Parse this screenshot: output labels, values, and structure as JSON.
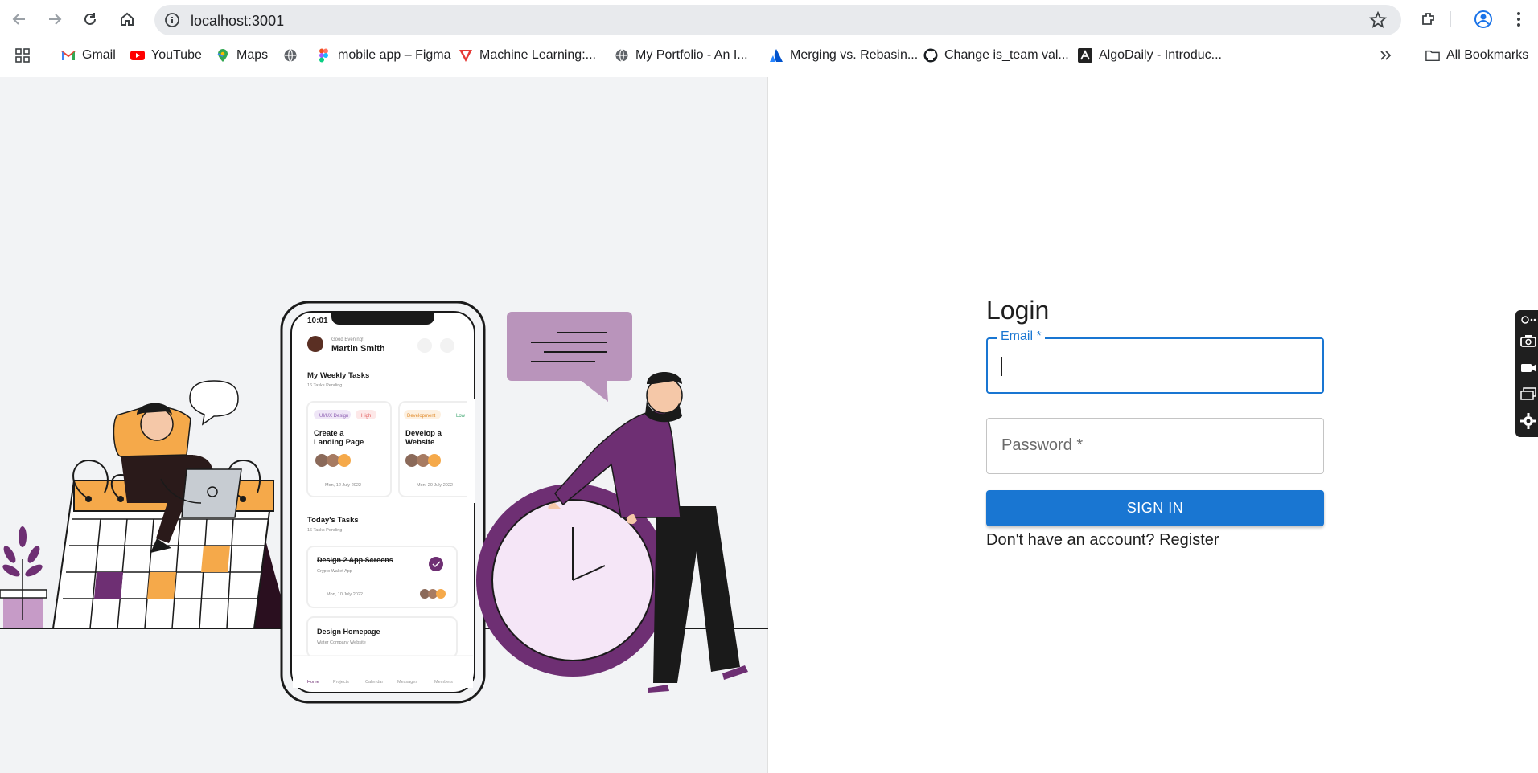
{
  "browser": {
    "url": "localhost:3001",
    "nav": {
      "back": "back-arrow-icon",
      "forward": "forward-arrow-icon",
      "reload": "reload-icon",
      "home": "home-icon"
    }
  },
  "bookmarks": {
    "items": [
      {
        "label": "Gmail",
        "icon": "gmail-icon"
      },
      {
        "label": "YouTube",
        "icon": "youtube-icon"
      },
      {
        "label": "Maps",
        "icon": "maps-icon"
      },
      {
        "label": "",
        "icon": "globe-icon"
      },
      {
        "label": "mobile app – Figma",
        "icon": "figma-icon"
      },
      {
        "label": "Machine Learning:...",
        "icon": "ml-icon"
      },
      {
        "label": "My Portfolio - An I...",
        "icon": "globe-icon"
      },
      {
        "label": "Merging vs. Rebasin...",
        "icon": "atlassian-icon"
      },
      {
        "label": "Change is_team val...",
        "icon": "github-icon"
      },
      {
        "label": "AlgoDaily - Introduc...",
        "icon": "algodaily-icon"
      }
    ],
    "all_bookmarks": "All Bookmarks"
  },
  "hero": {
    "phone": {
      "time": "10:01",
      "greeting": "Good Evening!",
      "user": "Martin Smith",
      "weekly_title": "My Weekly Tasks",
      "weekly_sub": "16 Tasks Pending",
      "card1": {
        "tag1": "UI/UX Design",
        "tag2": "High",
        "title1": "Create a",
        "title2": "Landing Page",
        "date": "Mon, 12 July 2022"
      },
      "card2": {
        "tag1": "Development",
        "tag2": "Low",
        "title1": "Develop a",
        "title2": "Website",
        "date": "Mon, 20 July 2022"
      },
      "today_title": "Today's Tasks",
      "today_sub": "16 Tasks Pending",
      "task1": {
        "title": "Design 2 App Screens",
        "sub": "Crypto Wallet App",
        "date": "Mon, 10 July 2022"
      },
      "task2": {
        "title": "Design Homepage",
        "sub": "Water Company Website"
      },
      "nav": [
        "Home",
        "Projects",
        "Calendar",
        "Messages",
        "Members"
      ]
    }
  },
  "login": {
    "title": "Login",
    "email_label": "Email *",
    "password_label": "Password *",
    "signin": "SIGN IN",
    "register_text": "Don't have an account? Register"
  },
  "colors": {
    "primary": "#1976d2",
    "purple": "#6e2f73",
    "orange": "#f5a94a",
    "lilac": "#b994bb"
  }
}
